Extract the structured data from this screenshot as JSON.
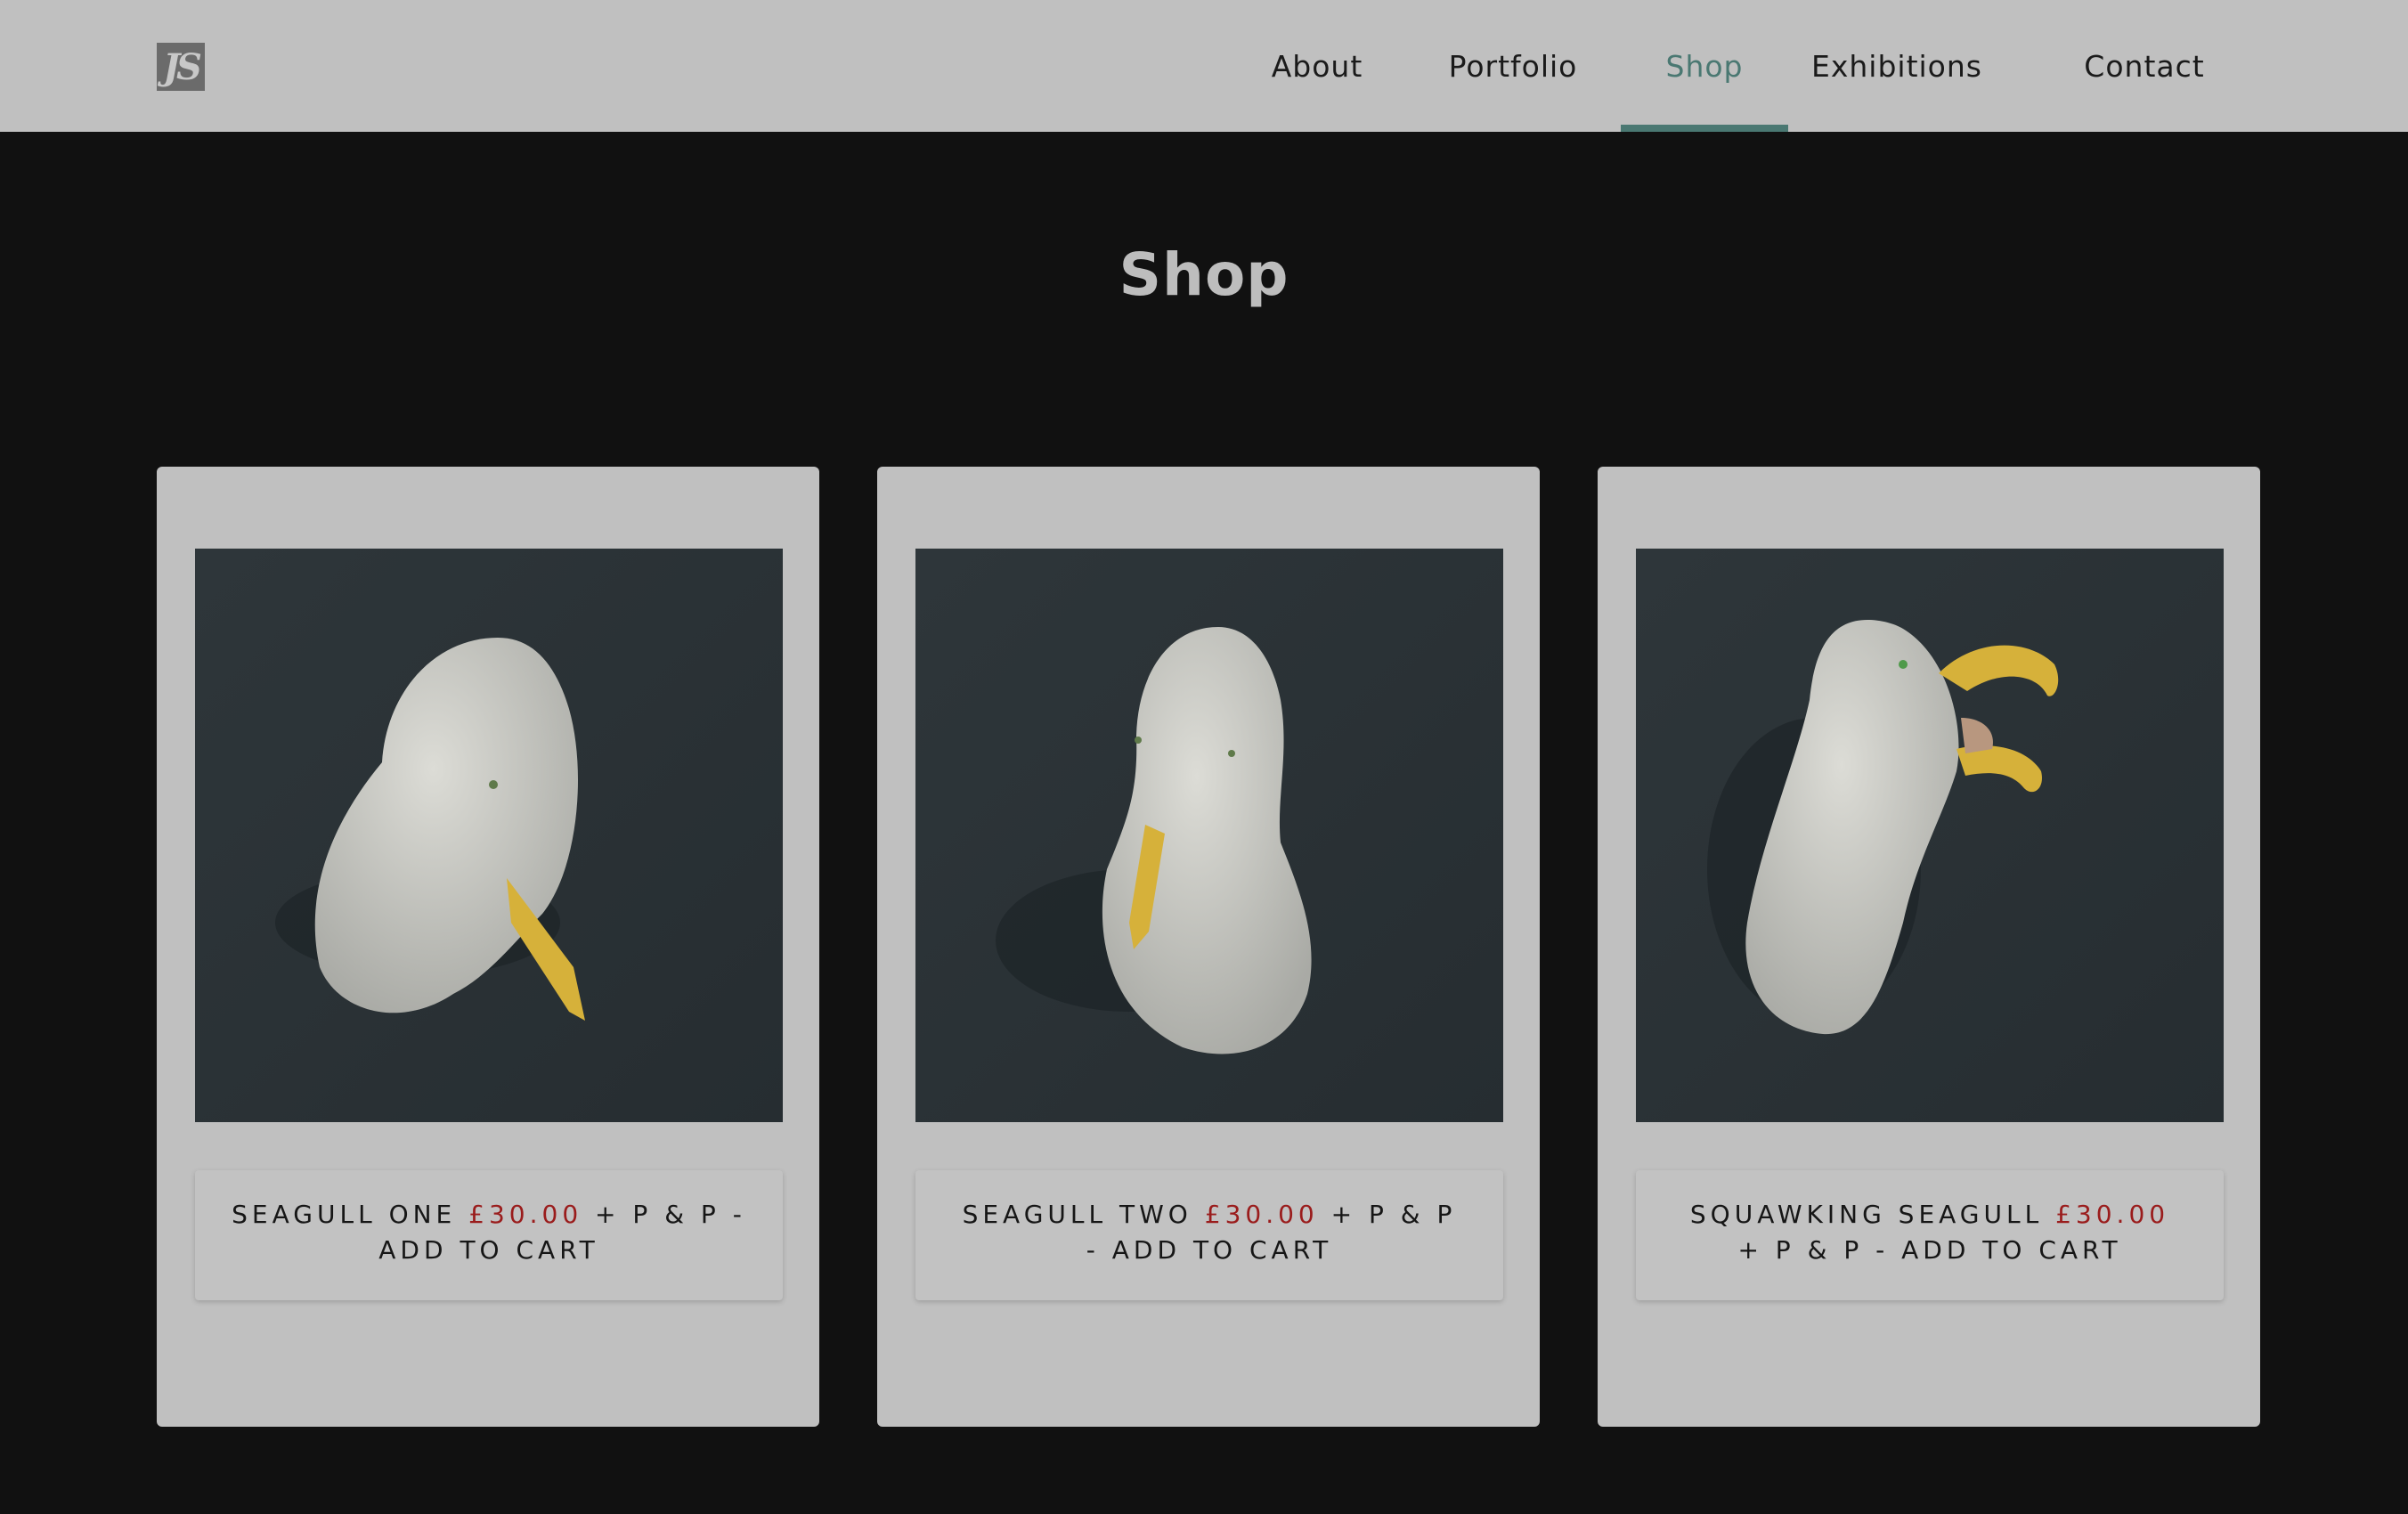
{
  "header": {
    "logo_text": "JS",
    "nav": [
      {
        "label": "About"
      },
      {
        "label": "Portfolio"
      },
      {
        "label": "Shop",
        "active": true
      },
      {
        "label": "Exhibitions"
      },
      {
        "label": "Contact"
      }
    ]
  },
  "page": {
    "title": "Shop"
  },
  "products": [
    {
      "name": "SEAGULL ONE",
      "price": "£30.00",
      "suffix": "+ P & P - ADD TO CART",
      "image_icon": "seagull-head-facing-down-photo"
    },
    {
      "name": "SEAGULL TWO",
      "price": "£30.00",
      "suffix": "+ P & P - ADD TO CART",
      "image_icon": "seagull-head-front-photo"
    },
    {
      "name": "SQUAWKING SEAGULL",
      "price": "£30.00",
      "suffix": "+ P & P - ADD TO CART",
      "image_icon": "seagull-head-squawking-photo"
    }
  ],
  "colors": {
    "header_bg": "#c0c0c0",
    "page_bg": "#111111",
    "accent": "#4a7872",
    "price": "#9a1c1c",
    "card_bg": "#c0c0c0",
    "photo_bg": "#2a3135"
  }
}
